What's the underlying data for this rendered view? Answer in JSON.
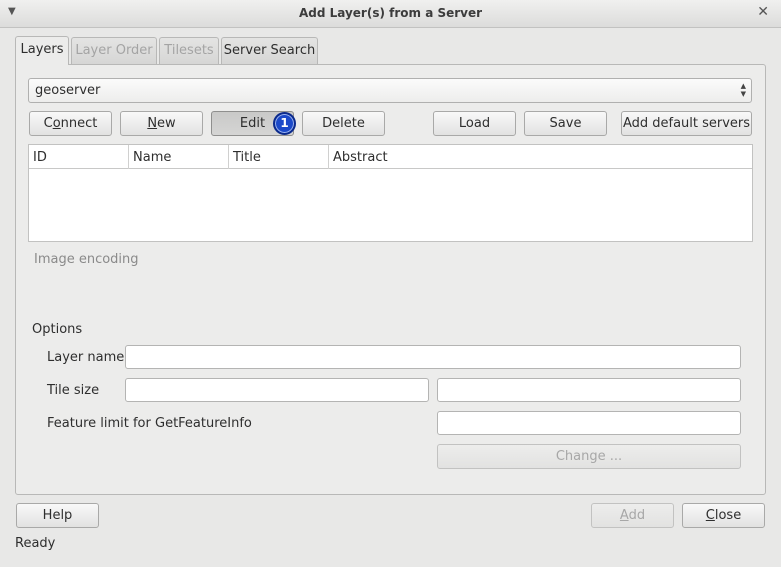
{
  "window": {
    "title": "Add Layer(s) from a Server",
    "menu_icon": "chevron-down-icon",
    "close_icon": "close-icon"
  },
  "tabs": [
    {
      "label": "Layers",
      "state": "active"
    },
    {
      "label": "Layer Order",
      "state": "disabled"
    },
    {
      "label": "Tilesets",
      "state": "disabled"
    },
    {
      "label": "Server Search",
      "state": "enabled"
    }
  ],
  "connection": {
    "selected": "geoserver"
  },
  "buttons": {
    "connect": {
      "pre": "C",
      "u": "o",
      "post": "nnect"
    },
    "new": {
      "pre": "",
      "u": "N",
      "post": "ew"
    },
    "edit": "Edit",
    "delete": "Delete",
    "load": "Load",
    "save": "Save",
    "add_default": "Add default servers"
  },
  "annotation_badge": "1",
  "layers_table": {
    "columns": [
      "ID",
      "Name",
      "Title",
      "Abstract"
    ],
    "rows": []
  },
  "image_encoding_label": "Image encoding",
  "options": {
    "heading": "Options",
    "layer_name_label": "Layer name",
    "tile_size_label": "Tile size",
    "feature_limit_label": "Feature limit for GetFeatureInfo",
    "change_button": "Change ..."
  },
  "footer": {
    "help": "Help",
    "add": {
      "pre": "",
      "u": "A",
      "post": "dd"
    },
    "close": {
      "pre": "",
      "u": "C",
      "post": "lose"
    }
  },
  "status": "Ready",
  "colors": {
    "badge": "#1b49c9",
    "window_bg": "#e8e8e7"
  }
}
